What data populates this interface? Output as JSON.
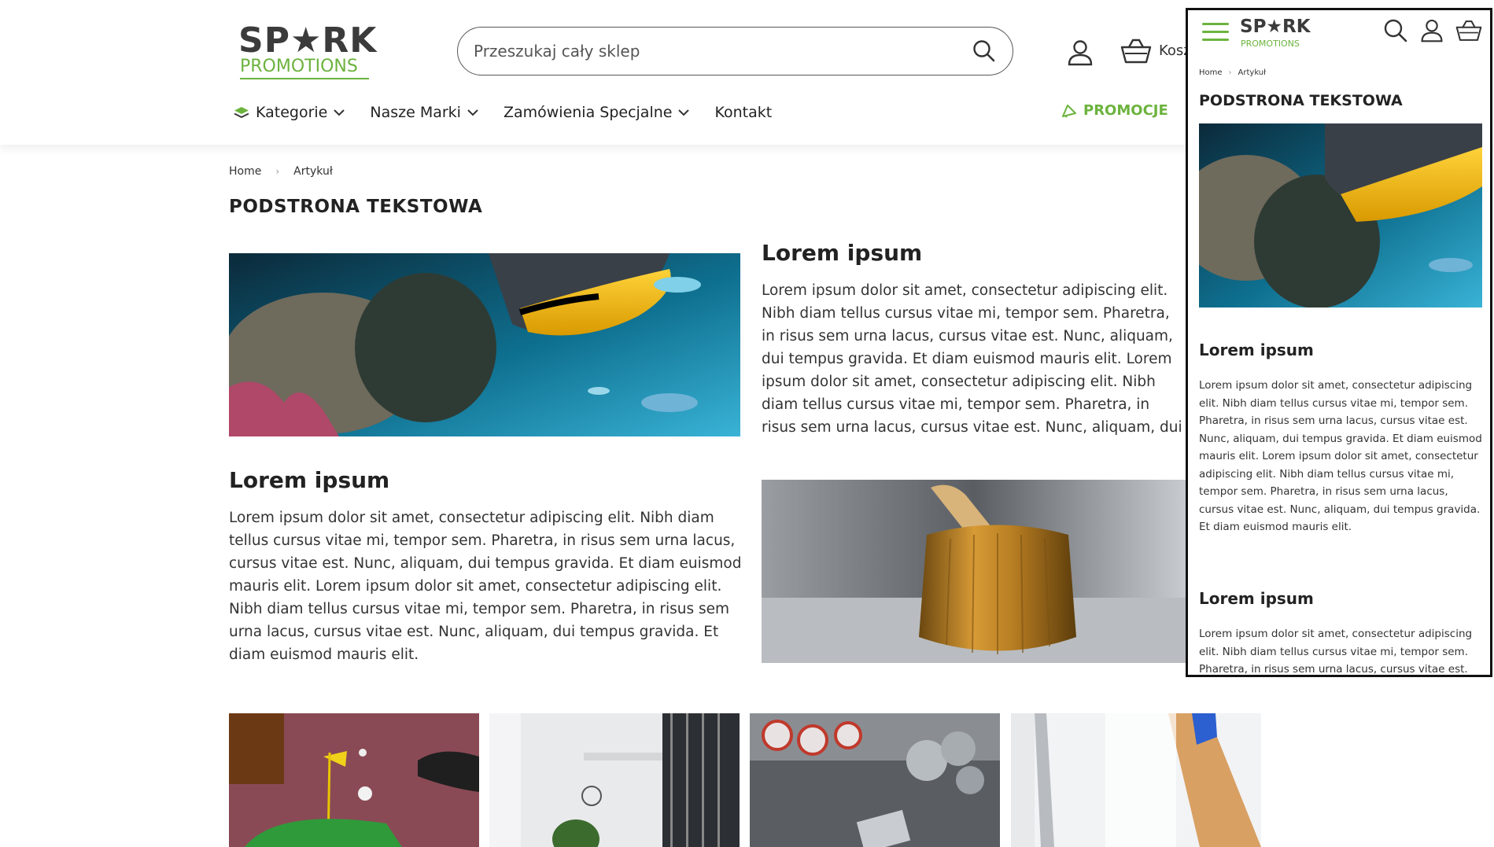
{
  "header": {
    "logo_top": "SP★RK",
    "logo_bottom": "PROMOTIONS",
    "search_placeholder": "Przeszukaj cały sklep",
    "cart_label": "Kosz",
    "nav": [
      {
        "label": "Kategorie",
        "has_dropdown": true,
        "icon": "categories-icon"
      },
      {
        "label": "Nasze Marki",
        "has_dropdown": true
      },
      {
        "label": "Zamówienia Specjalne",
        "has_dropdown": true
      },
      {
        "label": "Kontakt",
        "has_dropdown": false
      }
    ],
    "promo_label": "PROMOCJE"
  },
  "breadcrumb": {
    "home": "Home",
    "current": "Artykuł"
  },
  "page_title": "PODSTRONA TEKSTOWA",
  "sections": [
    {
      "heading": "Lorem ipsum",
      "body": "Lorem ipsum dolor sit amet, consectetur adipiscing elit. Nibh diam tellus cursus vitae mi, tempor sem. Pharetra, in risus sem urna lacus, cursus vitae est. Nunc, aliquam, dui tempus gravida. Et diam euismod mauris elit. Lorem ipsum dolor sit amet, consectetur adipiscing elit. Nibh diam tellus cursus vitae mi, tempor sem. Pharetra, in risus sem urna lacus, cursus vitae est. Nunc, aliquam, dui tempus gravida. Et diam euismod mauris elit.",
      "image": "underwater-scene"
    },
    {
      "heading": "Lorem ipsum",
      "body": "Lorem ipsum dolor sit amet, consectetur adipiscing elit. Nibh diam tellus cursus vitae mi, tempor sem. Pharetra, in risus sem urna lacus, cursus vitae est. Nunc, aliquam, dui tempus gravida. Et diam euismod mauris elit. Lorem ipsum dolor sit amet, consectetur adipiscing elit. Nibh diam tellus cursus vitae mi, tempor sem. Pharetra, in risus sem urna lacus, cursus vitae est. Nunc, aliquam, dui tempus gravida. Et diam euismod mauris elit.",
      "image": "bamboo-mortar"
    }
  ],
  "gallery": [
    "mini-golf",
    "office-interior",
    "coins-on-desk",
    "pen-closeup"
  ],
  "mobile": {
    "logo_top": "SP★RK",
    "logo_bottom": "PROMOTIONS",
    "breadcrumb_home": "Home",
    "breadcrumb_current": "Artykuł",
    "title": "PODSTRONA TEKSTOWA",
    "sections": [
      {
        "heading": "Lorem ipsum",
        "body": "Lorem ipsum dolor sit amet, consectetur adipiscing elit. Nibh diam tellus cursus vitae mi, tempor sem. Pharetra, in risus sem urna lacus, cursus vitae est. Nunc, aliquam, dui tempus gravida. Et diam euismod mauris elit. Lorem ipsum dolor sit amet, consectetur adipiscing elit. Nibh diam tellus cursus vitae mi, tempor sem. Pharetra, in risus sem urna lacus, cursus vitae est. Nunc, aliquam, dui tempus gravida. Et diam euismod mauris elit."
      },
      {
        "heading": "Lorem ipsum",
        "body": "Lorem ipsum dolor sit amet, consectetur adipiscing elit. Nibh diam tellus cursus vitae mi, tempor sem. Pharetra, in risus sem urna lacus, cursus vitae est. Nunc, aliquam, dui tempus gravida."
      }
    ]
  },
  "colors": {
    "brand_green": "#6cb33e",
    "text_dark": "#222222",
    "border_dark": "#111111"
  }
}
